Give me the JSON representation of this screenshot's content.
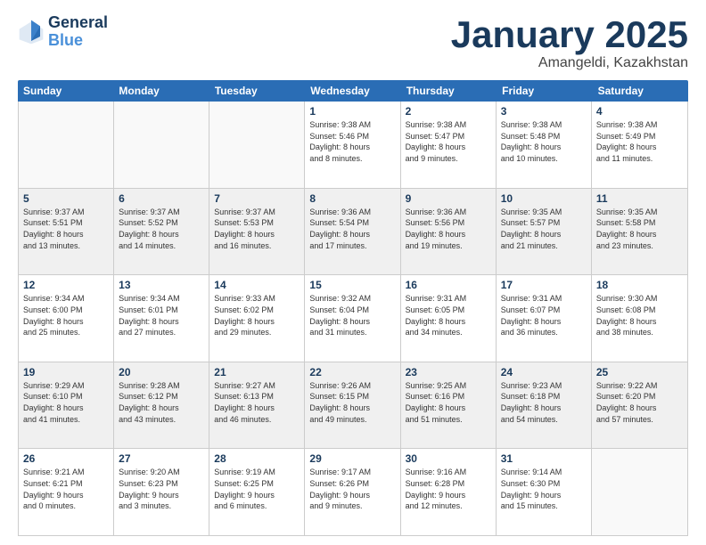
{
  "logo": {
    "line1": "General",
    "line2": "Blue"
  },
  "title": "January 2025",
  "subtitle": "Amangeldi, Kazakhstan",
  "days_of_week": [
    "Sunday",
    "Monday",
    "Tuesday",
    "Wednesday",
    "Thursday",
    "Friday",
    "Saturday"
  ],
  "weeks": [
    [
      {
        "day": "",
        "info": ""
      },
      {
        "day": "",
        "info": ""
      },
      {
        "day": "",
        "info": ""
      },
      {
        "day": "1",
        "info": "Sunrise: 9:38 AM\nSunset: 5:46 PM\nDaylight: 8 hours\nand 8 minutes."
      },
      {
        "day": "2",
        "info": "Sunrise: 9:38 AM\nSunset: 5:47 PM\nDaylight: 8 hours\nand 9 minutes."
      },
      {
        "day": "3",
        "info": "Sunrise: 9:38 AM\nSunset: 5:48 PM\nDaylight: 8 hours\nand 10 minutes."
      },
      {
        "day": "4",
        "info": "Sunrise: 9:38 AM\nSunset: 5:49 PM\nDaylight: 8 hours\nand 11 minutes."
      }
    ],
    [
      {
        "day": "5",
        "info": "Sunrise: 9:37 AM\nSunset: 5:51 PM\nDaylight: 8 hours\nand 13 minutes."
      },
      {
        "day": "6",
        "info": "Sunrise: 9:37 AM\nSunset: 5:52 PM\nDaylight: 8 hours\nand 14 minutes."
      },
      {
        "day": "7",
        "info": "Sunrise: 9:37 AM\nSunset: 5:53 PM\nDaylight: 8 hours\nand 16 minutes."
      },
      {
        "day": "8",
        "info": "Sunrise: 9:36 AM\nSunset: 5:54 PM\nDaylight: 8 hours\nand 17 minutes."
      },
      {
        "day": "9",
        "info": "Sunrise: 9:36 AM\nSunset: 5:56 PM\nDaylight: 8 hours\nand 19 minutes."
      },
      {
        "day": "10",
        "info": "Sunrise: 9:35 AM\nSunset: 5:57 PM\nDaylight: 8 hours\nand 21 minutes."
      },
      {
        "day": "11",
        "info": "Sunrise: 9:35 AM\nSunset: 5:58 PM\nDaylight: 8 hours\nand 23 minutes."
      }
    ],
    [
      {
        "day": "12",
        "info": "Sunrise: 9:34 AM\nSunset: 6:00 PM\nDaylight: 8 hours\nand 25 minutes."
      },
      {
        "day": "13",
        "info": "Sunrise: 9:34 AM\nSunset: 6:01 PM\nDaylight: 8 hours\nand 27 minutes."
      },
      {
        "day": "14",
        "info": "Sunrise: 9:33 AM\nSunset: 6:02 PM\nDaylight: 8 hours\nand 29 minutes."
      },
      {
        "day": "15",
        "info": "Sunrise: 9:32 AM\nSunset: 6:04 PM\nDaylight: 8 hours\nand 31 minutes."
      },
      {
        "day": "16",
        "info": "Sunrise: 9:31 AM\nSunset: 6:05 PM\nDaylight: 8 hours\nand 34 minutes."
      },
      {
        "day": "17",
        "info": "Sunrise: 9:31 AM\nSunset: 6:07 PM\nDaylight: 8 hours\nand 36 minutes."
      },
      {
        "day": "18",
        "info": "Sunrise: 9:30 AM\nSunset: 6:08 PM\nDaylight: 8 hours\nand 38 minutes."
      }
    ],
    [
      {
        "day": "19",
        "info": "Sunrise: 9:29 AM\nSunset: 6:10 PM\nDaylight: 8 hours\nand 41 minutes."
      },
      {
        "day": "20",
        "info": "Sunrise: 9:28 AM\nSunset: 6:12 PM\nDaylight: 8 hours\nand 43 minutes."
      },
      {
        "day": "21",
        "info": "Sunrise: 9:27 AM\nSunset: 6:13 PM\nDaylight: 8 hours\nand 46 minutes."
      },
      {
        "day": "22",
        "info": "Sunrise: 9:26 AM\nSunset: 6:15 PM\nDaylight: 8 hours\nand 49 minutes."
      },
      {
        "day": "23",
        "info": "Sunrise: 9:25 AM\nSunset: 6:16 PM\nDaylight: 8 hours\nand 51 minutes."
      },
      {
        "day": "24",
        "info": "Sunrise: 9:23 AM\nSunset: 6:18 PM\nDaylight: 8 hours\nand 54 minutes."
      },
      {
        "day": "25",
        "info": "Sunrise: 9:22 AM\nSunset: 6:20 PM\nDaylight: 8 hours\nand 57 minutes."
      }
    ],
    [
      {
        "day": "26",
        "info": "Sunrise: 9:21 AM\nSunset: 6:21 PM\nDaylight: 9 hours\nand 0 minutes."
      },
      {
        "day": "27",
        "info": "Sunrise: 9:20 AM\nSunset: 6:23 PM\nDaylight: 9 hours\nand 3 minutes."
      },
      {
        "day": "28",
        "info": "Sunrise: 9:19 AM\nSunset: 6:25 PM\nDaylight: 9 hours\nand 6 minutes."
      },
      {
        "day": "29",
        "info": "Sunrise: 9:17 AM\nSunset: 6:26 PM\nDaylight: 9 hours\nand 9 minutes."
      },
      {
        "day": "30",
        "info": "Sunrise: 9:16 AM\nSunset: 6:28 PM\nDaylight: 9 hours\nand 12 minutes."
      },
      {
        "day": "31",
        "info": "Sunrise: 9:14 AM\nSunset: 6:30 PM\nDaylight: 9 hours\nand 15 minutes."
      },
      {
        "day": "",
        "info": ""
      }
    ]
  ]
}
